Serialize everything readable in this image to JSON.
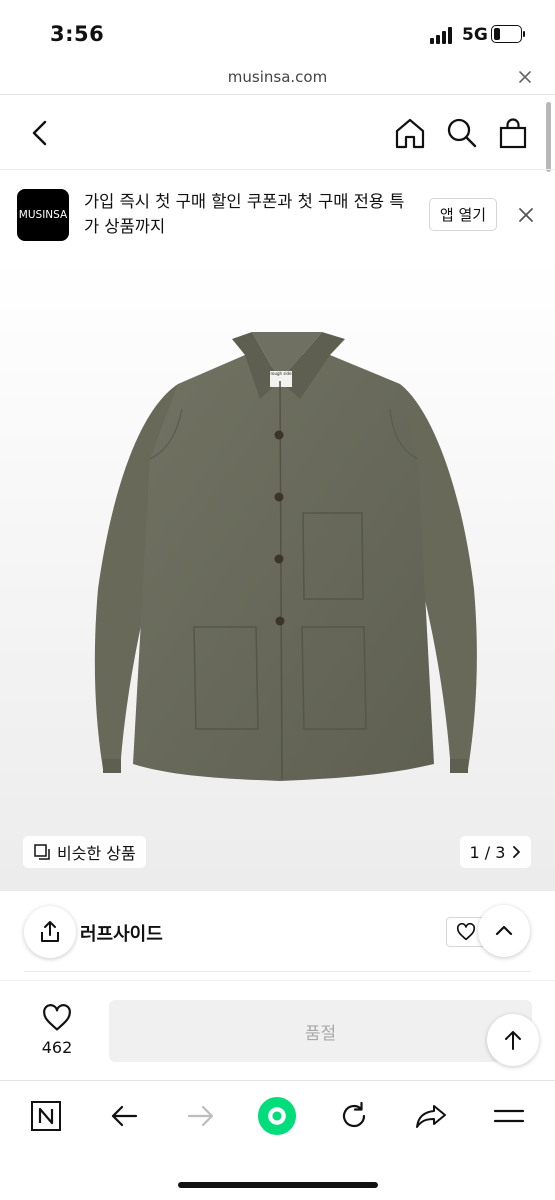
{
  "status_bar": {
    "time": "3:56",
    "network": "5G",
    "battery_level": 0.25
  },
  "browser": {
    "url": "musinsa.com"
  },
  "promo": {
    "logo_text": "MUSINSA",
    "message": "가입 즉시 첫 구매 할인 쿠폰과 첫 구매 전용 특가 상품까지",
    "open_app_label": "앱 열기"
  },
  "gallery": {
    "similar_label": "비슷한 상품",
    "pager": "1 / 3",
    "tag_text": "rough side"
  },
  "product": {
    "brand": "러프사이드",
    "like_count": "462",
    "soldout_label": "품절"
  },
  "colors": {
    "brand_black": "#000000",
    "jacket_olive": "#6b6c5c",
    "toolbar_green": "#00dd7a",
    "soldout_bg": "#f0f0f0"
  },
  "icons": [
    "back-icon",
    "home-icon",
    "search-icon",
    "bag-icon",
    "close-icon",
    "share-icon",
    "heart-icon",
    "chevron-up-icon",
    "arrow-up-icon",
    "naver-n-icon",
    "arrow-left-icon",
    "arrow-right-icon",
    "refresh-icon",
    "share-arrow-icon",
    "menu-icon"
  ]
}
